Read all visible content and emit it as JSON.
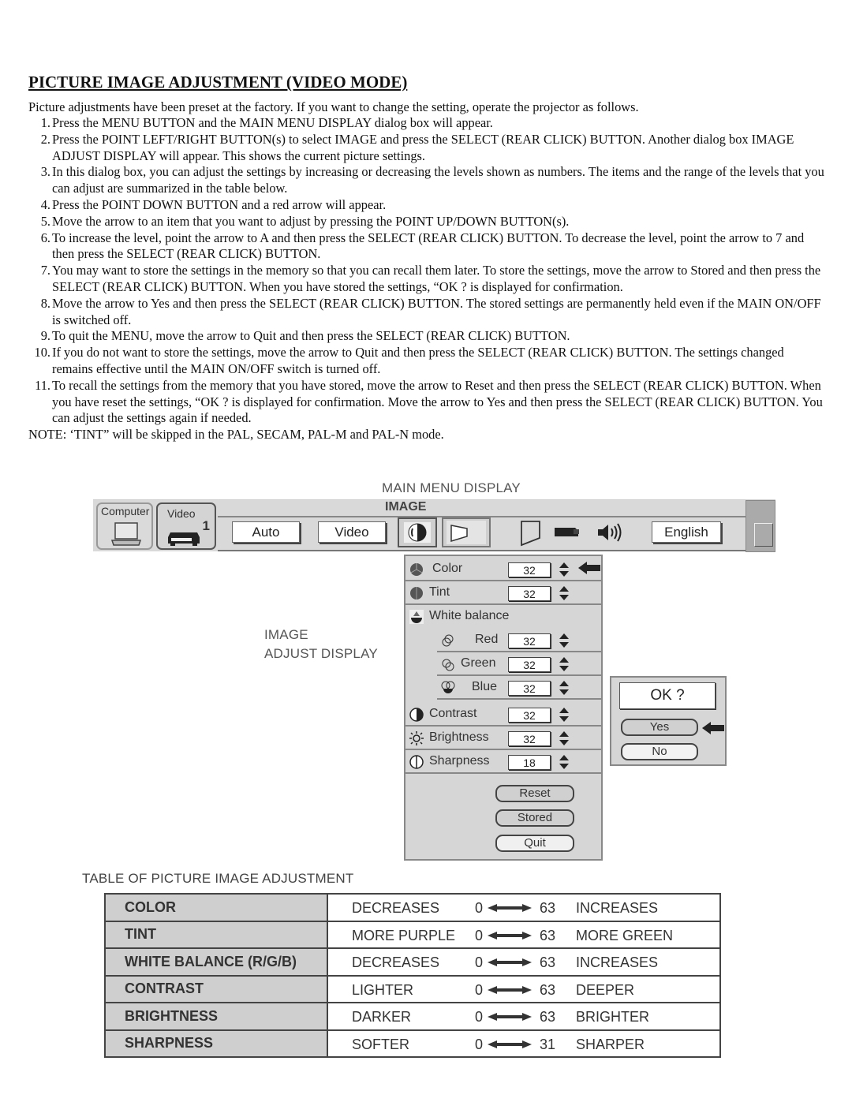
{
  "document": {
    "title": "PICTURE IMAGE ADJUSTMENT (VIDEO MODE)",
    "intro": "Picture adjustments have been preset at the factory. If you want to change the setting, operate the projector as follows.",
    "steps": [
      {
        "num": "1.",
        "text": "Press the MENU BUTTON and the MAIN MENU DISPLAY dialog box will appear."
      },
      {
        "num": "2.",
        "text": "Press the POINT LEFT/RIGHT BUTTON(s) to select IMAGE and press the SELECT (REAR CLICK) BUTTON. Another dialog box IMAGE ADJUST DISPLAY will appear. This shows the current picture settings."
      },
      {
        "num": "3.",
        "text": "In this dialog box, you can adjust the settings by increasing or decreasing the levels shown as numbers. The items and the range of the levels that you can adjust are summarized in the table below."
      },
      {
        "num": "4.",
        "text": "Press the POINT DOWN BUTTON and a red arrow will appear."
      },
      {
        "num": "5.",
        "text": "Move the arrow to an item that you want to adjust by pressing the POINT UP/DOWN BUTTON(s)."
      },
      {
        "num": "6.",
        "text": "To increase the level, point the arrow to A and then press the SELECT (REAR CLICK) BUTTON. To decrease the level, point the arrow to 7 and then press the SELECT (REAR CLICK) BUTTON."
      },
      {
        "num": "7.",
        "text": "You may want to store the settings in the memory so that you can recall them later. To store the settings, move the arrow to Stored and then press the SELECT (REAR CLICK) BUTTON. When you have stored the settings, “OK ? is displayed for confirmation."
      },
      {
        "num": "8.",
        "text": "Move the arrow to Yes and then press the SELECT (REAR CLICK) BUTTON. The stored settings are permanently held even if the MAIN ON/OFF is switched off."
      },
      {
        "num": "9.",
        "text": "To quit the MENU, move the arrow to Quit and then press the SELECT (REAR CLICK) BUTTON."
      },
      {
        "num": "10.",
        "text": "If you do not want to store the settings, move the arrow to Quit and then press the SELECT (REAR CLICK) BUTTON. The settings changed remains effective until the MAIN ON/OFF switch is turned off."
      },
      {
        "num": "11.",
        "text": "To recall the settings from the memory that you have stored, move the arrow to Reset and then press the SELECT (REAR CLICK) BUTTON. When you have reset the settings, “OK ? is displayed for confirmation. Move the arrow to Yes and then press the SELECT (REAR CLICK) BUTTON. You can adjust the settings again if needed."
      }
    ],
    "note": "NOTE: ‘TINT” will be skipped in the PAL, SECAM, PAL-M and PAL-N mode."
  },
  "main_menu": {
    "caption": "MAIN MENU DISPLAY",
    "tabs": [
      {
        "label": "Computer",
        "icon": "laptop-icon"
      },
      {
        "label": "Video",
        "number": "1",
        "icon": "vcr-icon"
      }
    ],
    "buttons": {
      "auto": "Auto",
      "video": "Video",
      "language": "English"
    },
    "selected_label": "IMAGE",
    "icons": [
      "image-adjust-icon",
      "screen-icon",
      "keystone-icon",
      "projector-icon",
      "speaker-icon"
    ]
  },
  "image_adjust": {
    "caption_line1": "IMAGE",
    "caption_line2": "ADJUST DISPLAY",
    "items": [
      {
        "label": "Color",
        "value": "32",
        "icon": "color-icon"
      },
      {
        "label": "Tint",
        "value": "32",
        "icon": "tint-icon"
      },
      {
        "label": "White balance",
        "icon": "white-balance-icon"
      },
      {
        "label": "Red",
        "value": "32",
        "icon": "red-icon"
      },
      {
        "label": "Green",
        "value": "32",
        "icon": "green-icon"
      },
      {
        "label": "Blue",
        "value": "32",
        "icon": "blue-icon"
      },
      {
        "label": "Contrast",
        "value": "32",
        "icon": "contrast-icon"
      },
      {
        "label": "Brightness",
        "value": "32",
        "icon": "brightness-icon"
      },
      {
        "label": "Sharpness",
        "value": "18",
        "icon": "sharpness-icon"
      }
    ],
    "buttons": {
      "reset": "Reset",
      "stored": "Stored",
      "quit": "Quit"
    }
  },
  "ok_dialog": {
    "message": "OK ?",
    "yes": "Yes",
    "no": "No"
  },
  "table": {
    "title": "TABLE OF PICTURE IMAGE ADJUSTMENT",
    "rows": [
      {
        "item": "COLOR",
        "low": "DECREASES",
        "min": "0",
        "max": "63",
        "high": "INCREASES"
      },
      {
        "item": "TINT",
        "low": "MORE PURPLE",
        "min": "0",
        "max": "63",
        "high": "MORE GREEN"
      },
      {
        "item": "WHITE BALANCE (R/G/B)",
        "low": "DECREASES",
        "min": "0",
        "max": "63",
        "high": "INCREASES"
      },
      {
        "item": "CONTRAST",
        "low": "LIGHTER",
        "min": "0",
        "max": "63",
        "high": "DEEPER"
      },
      {
        "item": "BRIGHTNESS",
        "low": "DARKER",
        "min": "0",
        "max": "63",
        "high": "BRIGHTER"
      },
      {
        "item": "SHARPNESS",
        "low": "SOFTER",
        "min": "0",
        "max": "31",
        "high": "SHARPER"
      }
    ]
  }
}
